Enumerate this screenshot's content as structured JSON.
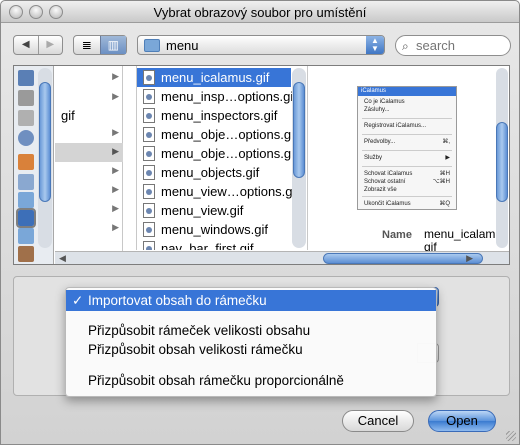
{
  "window": {
    "title": "Vybrat obrazový soubor pro umístění"
  },
  "toolbar": {
    "back_glyph": "◀",
    "forward_glyph": "▶",
    "list_view_glyph": "≣",
    "column_view_glyph": "▥",
    "path": "menu",
    "search_placeholder": "search"
  },
  "sidebar": {
    "icons": [
      "desktop-icon",
      "hard-drive-icon",
      "disk-icon",
      "network-icon",
      "applications-icon",
      "documents-icon",
      "folder-icon",
      "folder-selected-icon",
      "folder-icon",
      "home-icon"
    ]
  },
  "column1": {
    "rows": [
      "",
      "",
      "gif",
      "",
      "",
      "",
      "",
      "",
      "",
      ""
    ],
    "highlighted_index": 4
  },
  "files": [
    "menu_icalamus.gif",
    "menu_insp…options.gif",
    "menu_inspectors.gif",
    "menu_obje…options.gif",
    "menu_obje…options.gif",
    "menu_objects.gif",
    "menu_view…options.gif",
    "menu_view.gif",
    "menu_windows.gif",
    "nav_bar_first.gif"
  ],
  "selected_file_index": 0,
  "preview": {
    "thumb_title": "iCalamus",
    "thumb_items": [
      {
        "label": "Co je iCalamus",
        "shortcut": ""
      },
      {
        "label": "Zásluhy...",
        "shortcut": ""
      },
      {
        "label": "Registrovat iCalamus...",
        "shortcut": ""
      },
      {
        "label": "Předvolby...",
        "shortcut": "⌘,"
      },
      {
        "label": "Služby",
        "shortcut": "▶"
      },
      {
        "label": "Schovat iCalamus",
        "shortcut": "⌘H"
      },
      {
        "label": "Schovat ostatní",
        "shortcut": "⌥⌘H"
      },
      {
        "label": "Zobrazit vše",
        "shortcut": ""
      },
      {
        "label": "Ukončit iCalamus",
        "shortcut": "⌘Q"
      }
    ],
    "name_label": "Name",
    "name_value": "menu_icalamu\ngif"
  },
  "popup_menu": {
    "items": [
      {
        "label": "Importovat obsah do rámečku",
        "checked": true
      },
      {
        "label": "Přizpůsobit rámeček velikosti obsahu",
        "checked": false
      },
      {
        "label": "Přizpůsobit obsah velikosti rámečku",
        "checked": false
      },
      {
        "label": "Přizpůsobit obsah rámečku proporcionálně",
        "checked": false
      }
    ],
    "check_glyph": "✓"
  },
  "buttons": {
    "cancel": "Cancel",
    "open": "Open"
  },
  "colors": {
    "selection": "#3875d7",
    "accent": "#5a93dc"
  }
}
